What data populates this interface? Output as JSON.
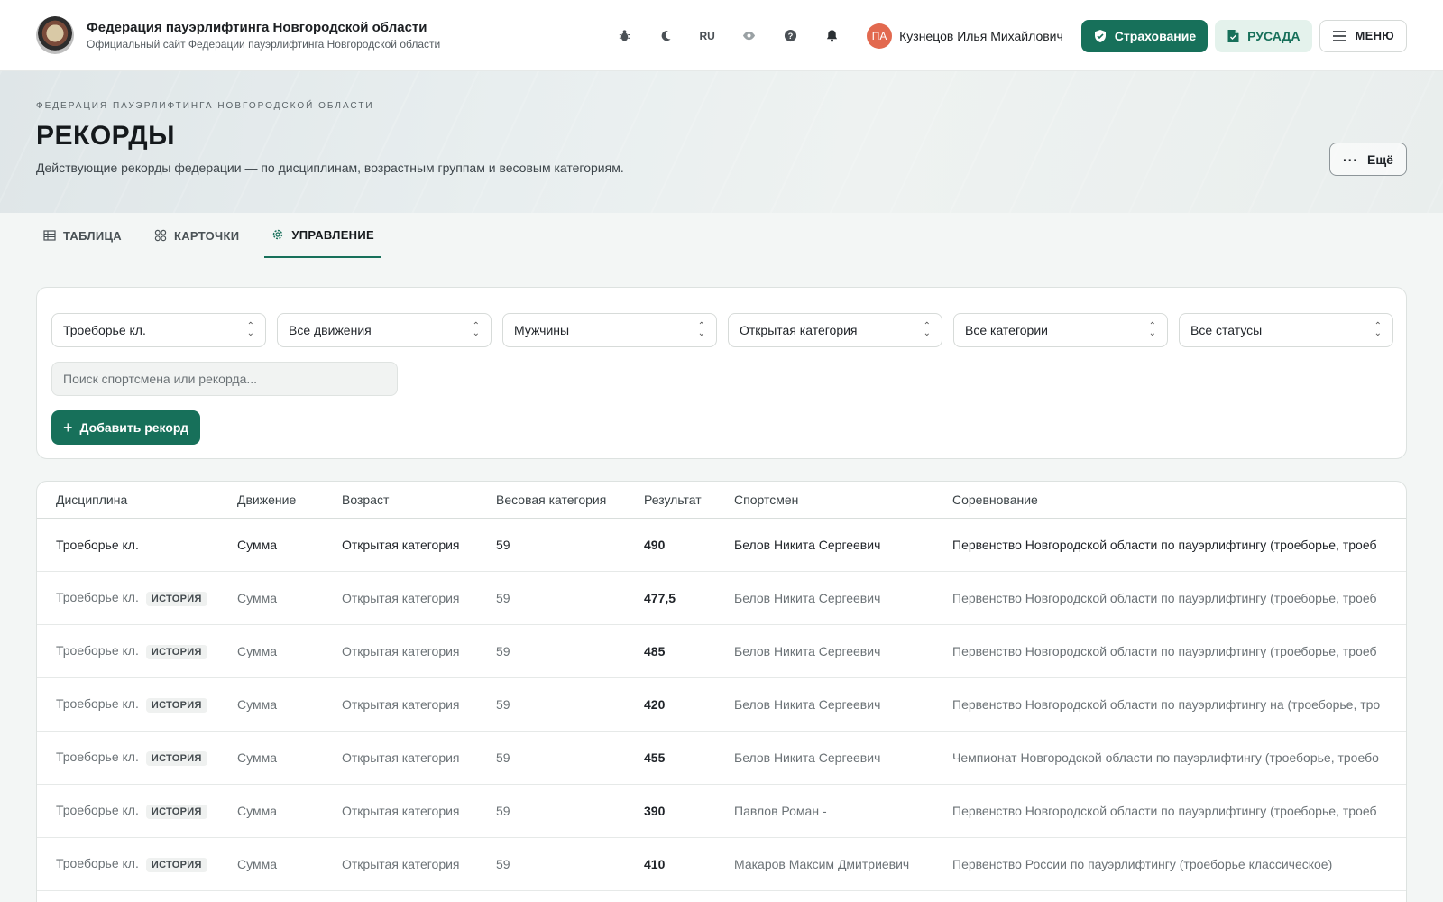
{
  "header": {
    "title": "Федерация пауэрлифтинга Новгородской области",
    "subtitle": "Официальный сайт Федерации пауэрлифтинга Новгородской области",
    "lang": "RU",
    "user_initials": "ПА",
    "user_name": "Кузнецов Илья Михайлович",
    "insurance_label": "Страхование",
    "rusada_label": "РУСАДА",
    "menu_label": "МЕНЮ"
  },
  "hero": {
    "kicker": "ФЕДЕРАЦИЯ ПАУЭРЛИФТИНГА НОВГОРОДСКОЙ ОБЛАСТИ",
    "title": "РЕКОРДЫ",
    "description": "Действующие рекорды федерации — по дисциплинам, возрастным группам и весовым категориям.",
    "more_label": "Ещё"
  },
  "tabs": [
    {
      "label": "ТАБЛИЦА",
      "icon": "table-icon"
    },
    {
      "label": "КАРТОЧКИ",
      "icon": "cards-icon"
    },
    {
      "label": "УПРАВЛЕНИЕ",
      "icon": "gear-icon"
    }
  ],
  "filters": {
    "discipline": "Троеборье кл.",
    "movement": "Все движения",
    "gender": "Мужчины",
    "age": "Открытая категория",
    "weight": "Все категории",
    "status": "Все статусы",
    "search_placeholder": "Поиск спортсмена или рекорда...",
    "add_label": "Добавить рекорд"
  },
  "table": {
    "columns": [
      "Дисциплина",
      "Движение",
      "Возраст",
      "Весовая категория",
      "Результат",
      "Спортсмен",
      "Соревнование"
    ],
    "history_label": "ИСТОРИЯ",
    "rows": [
      {
        "discipline": "Троеборье кл.",
        "history": false,
        "movement": "Сумма",
        "age": "Открытая категория",
        "weight": "59",
        "result": "490",
        "athlete": "Белов Никита Сергеевич",
        "competition": "Первенство Новгородской области по пауэрлифтингу (троеборье, троеб"
      },
      {
        "discipline": "Троеборье кл.",
        "history": true,
        "movement": "Сумма",
        "age": "Открытая категория",
        "weight": "59",
        "result": "477,5",
        "athlete": "Белов Никита Сергеевич",
        "competition": "Первенство Новгородской области по пауэрлифтингу (троеборье, троеб"
      },
      {
        "discipline": "Троеборье кл.",
        "history": true,
        "movement": "Сумма",
        "age": "Открытая категория",
        "weight": "59",
        "result": "485",
        "athlete": "Белов Никита Сергеевич",
        "competition": "Первенство Новгородской области по пауэрлифтингу (троеборье, троеб"
      },
      {
        "discipline": "Троеборье кл.",
        "history": true,
        "movement": "Сумма",
        "age": "Открытая категория",
        "weight": "59",
        "result": "420",
        "athlete": "Белов Никита Сергеевич",
        "competition": "Первенство Новгородской области по пауэрлифтингу на (троеборье, тро"
      },
      {
        "discipline": "Троеборье кл.",
        "history": true,
        "movement": "Сумма",
        "age": "Открытая категория",
        "weight": "59",
        "result": "455",
        "athlete": "Белов Никита Сергеевич",
        "competition": "Чемпионат Новгородской области по пауэрлифтингу (троеборье, троебо"
      },
      {
        "discipline": "Троеборье кл.",
        "history": true,
        "movement": "Сумма",
        "age": "Открытая категория",
        "weight": "59",
        "result": "390",
        "athlete": "Павлов Роман -",
        "competition": "Первенство Новгородской области по пауэрлифтингу (троеборье, троеб"
      },
      {
        "discipline": "Троеборье кл.",
        "history": true,
        "movement": "Сумма",
        "age": "Открытая категория",
        "weight": "59",
        "result": "410",
        "athlete": "Макаров Максим Дмитриевич",
        "competition": "Первенство России по пауэрлифтингу (троеборье классическое)"
      }
    ]
  },
  "colors": {
    "accent": "#17705a",
    "accent_light": "#e4f2ec",
    "avatar": "#e2694f"
  }
}
